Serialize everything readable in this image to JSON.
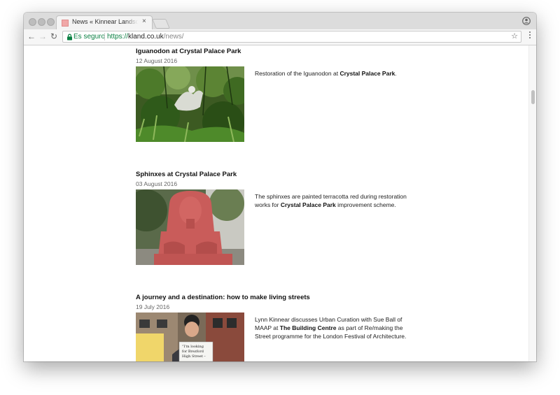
{
  "browser": {
    "tab_title": "News « Kinnear Landscape Architects",
    "tab_close": "×",
    "secure_label": "Es seguro",
    "url_scheme": "https://",
    "url_host": "kland.co.uk",
    "url_path": "/news/",
    "star": "☆"
  },
  "posts": [
    {
      "title": "Iguanodon at Crystal Palace Park",
      "date": "12 August 2016",
      "text_before": "Restoration of the Iguanodon at ",
      "text_bold": "Crystal Palace Park",
      "text_after": "."
    },
    {
      "title": "Sphinxes at Crystal Palace Park",
      "date": "03 August 2016",
      "text_before": "The sphinxes are painted terracotta red during restoration works for ",
      "text_bold": "Crystal Palace Park",
      "text_after": " improvement scheme."
    },
    {
      "title": "A journey and a destination: how to make living streets",
      "date": "19 July 2016",
      "text_before": "Lynn Kinnear discusses Urban Curation with Sue Ball of MAAP at ",
      "text_bold": "The Building Centre",
      "text_after": " as part of Re/making the Street programme for the London Festival of Architecture.",
      "sign_text": "\"I'm looking for Brezford High Street –"
    }
  ],
  "colors": {
    "secure_green": "#0b8043",
    "sphinx_red": "#c95c5a"
  }
}
